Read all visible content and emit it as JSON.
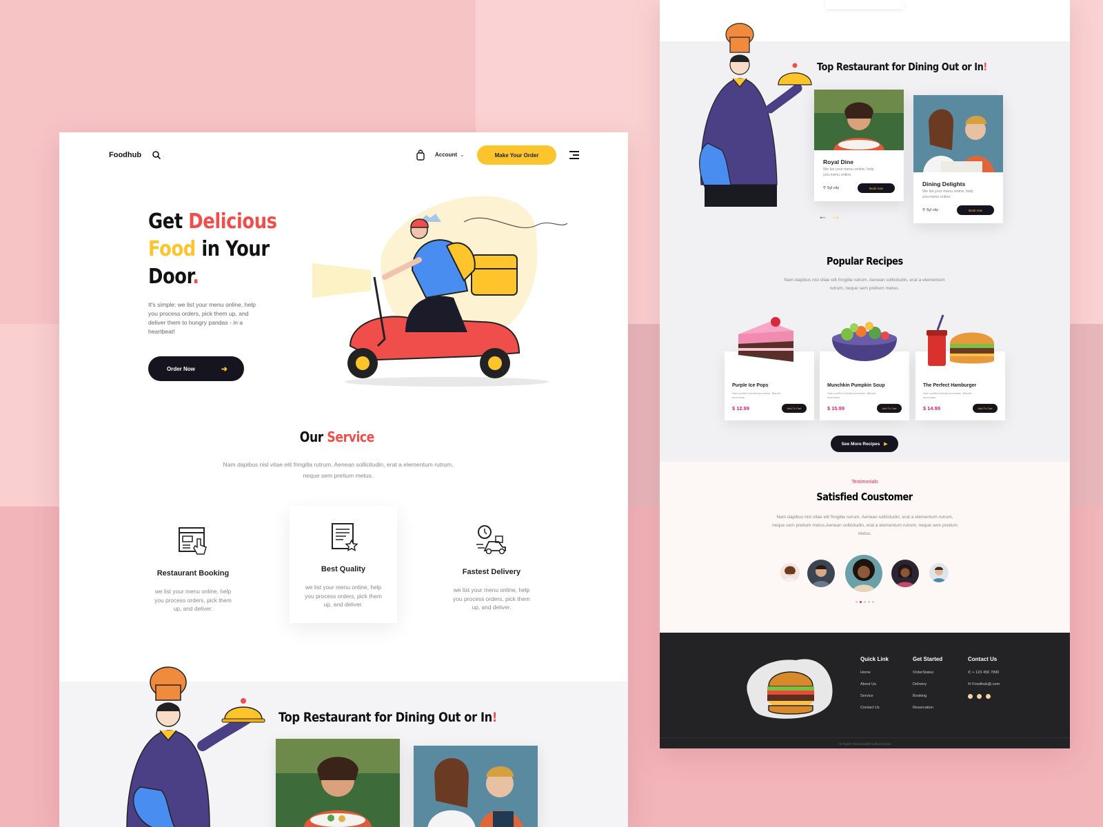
{
  "brand": {
    "name": "Foodhub",
    "accent_yellow": "#fdc42c",
    "accent_red": "#f04e4a",
    "dark": "#15141f",
    "pink": "#e91e63"
  },
  "nav": {
    "account_label": "Account",
    "cta_label": "Make Your Order"
  },
  "hero": {
    "w_get": "Get",
    "w_delicious": "Delicious",
    "w_food": "Food",
    "w_in_your": "in Your",
    "w_door": "Door",
    "w_dot": ".",
    "description": "It's simple: we list your menu online, help you process orders, pick them up, and deliver them to hungry pandas - in a heartbeat!",
    "button_label": "Order Now"
  },
  "service": {
    "title_a": "Our",
    "title_b": "Service",
    "subtitle": "Nam dapibus nisl vitae elit fringilla rutrum. Aenean sollicitudin, erat a elementum rutrum, neque sem pretium metus.",
    "items": [
      {
        "title": "Restaurant Booking",
        "desc": "we list your menu online, help you process orders, pick them up, and deliver.",
        "icon": "booking-icon"
      },
      {
        "title": "Best Quality",
        "desc": "we list your menu online, help you process orders, pick them up, and deliver.",
        "icon": "quality-icon"
      },
      {
        "title": "Fastest Delivery",
        "desc": "we list your menu online, help you process orders, pick them up, and deliver.",
        "icon": "delivery-icon"
      }
    ]
  },
  "restaurants": {
    "title": "Top Restaurant for Dining Out or In",
    "title_mark": "!",
    "cards": [
      {
        "name": "Royal Dine",
        "desc": "We list your menu online, help you menu online.",
        "location": "Syl city",
        "button": "Book now"
      },
      {
        "name": "Dining Delights",
        "desc": "We list your menu online, help you menu online.",
        "location": "Syl city",
        "button": "Book now"
      }
    ]
  },
  "recipes": {
    "title": "Popular Recipes",
    "subtitle": "Nam dapibus nisl vitae elit fringilla rutrum. Aenean sollicitudin, erat a elementum rutrum, neque sem pretium metus.",
    "items": [
      {
        "name": "Purple Ice Pops",
        "desc": "Nam porttitor blandit accumsan. Blandit accumsan.",
        "price": "$ 12.99",
        "button": "Add To Cart"
      },
      {
        "name": "Munchkin Pumpkin Soup",
        "desc": "Nam porttitor blandit accumsan. Blandit accumsan.",
        "price": "$ 15.99",
        "button": "Add To Cart"
      },
      {
        "name": "The Perfect Hamburger",
        "desc": "Nam porttitor blandit accumsan. Blandit accumsan.",
        "price": "$ 14.99",
        "button": "Add To Cart"
      }
    ],
    "more_label": "See More Recipes"
  },
  "testimonials": {
    "kicker": "Testimonials",
    "title": "Satisfied Coustomer",
    "desc": "Nam dapibus nisl vitae elit fringilla rutrum. Aenean sollicitudin, erat a elementum rutrum, neque sem pretium metus.Aenean sollicitudin, erat a elementum rutrum, neque sem pretium metus."
  },
  "footer": {
    "quick_link": {
      "head": "Quick Link",
      "items": [
        "Home",
        "About Us",
        "Service",
        "Contact Us"
      ]
    },
    "get_started": {
      "head": "Get Started",
      "items": [
        "OrderStatus",
        "Delivery",
        "Booking",
        "Reservation"
      ]
    },
    "contact": {
      "head": "Contact Us",
      "phone": "+ 123 456 7890",
      "email": "Foodhub@.com"
    },
    "copyright": "All Rights Reserved@Foodhub limited"
  }
}
